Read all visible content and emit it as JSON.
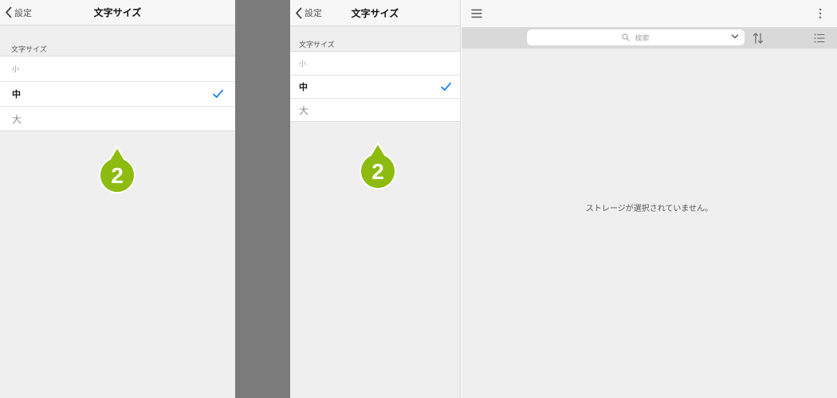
{
  "left_panel": {
    "back_label": "設定",
    "title": "文字サイズ",
    "section_header": "文字サイズ",
    "options": [
      {
        "label": "小",
        "selected": false
      },
      {
        "label": "中",
        "selected": true
      },
      {
        "label": "大",
        "selected": false
      }
    ],
    "step_number": "2"
  },
  "middle_panel": {
    "back_label": "設定",
    "title": "文字サイズ",
    "section_header": "文字サイズ",
    "options": [
      {
        "label": "小",
        "selected": false
      },
      {
        "label": "中",
        "selected": true
      },
      {
        "label": "大",
        "selected": false
      }
    ],
    "step_number": "2"
  },
  "right_panel": {
    "search": {
      "placeholder": "検索"
    },
    "empty_message": "ストレージが選択されていません。",
    "icons": {
      "menu": "hamburger-menu-icon",
      "more": "more-vertical-icon",
      "search": "search-icon",
      "dropdown": "chevron-down-icon",
      "sort": "sort-arrows-icon",
      "list": "list-view-icon"
    }
  },
  "colors": {
    "accent": "#0a7aff",
    "marker_green": "#8dbb10",
    "background": "#efefef",
    "divider_gap": "#7b7b7b"
  }
}
